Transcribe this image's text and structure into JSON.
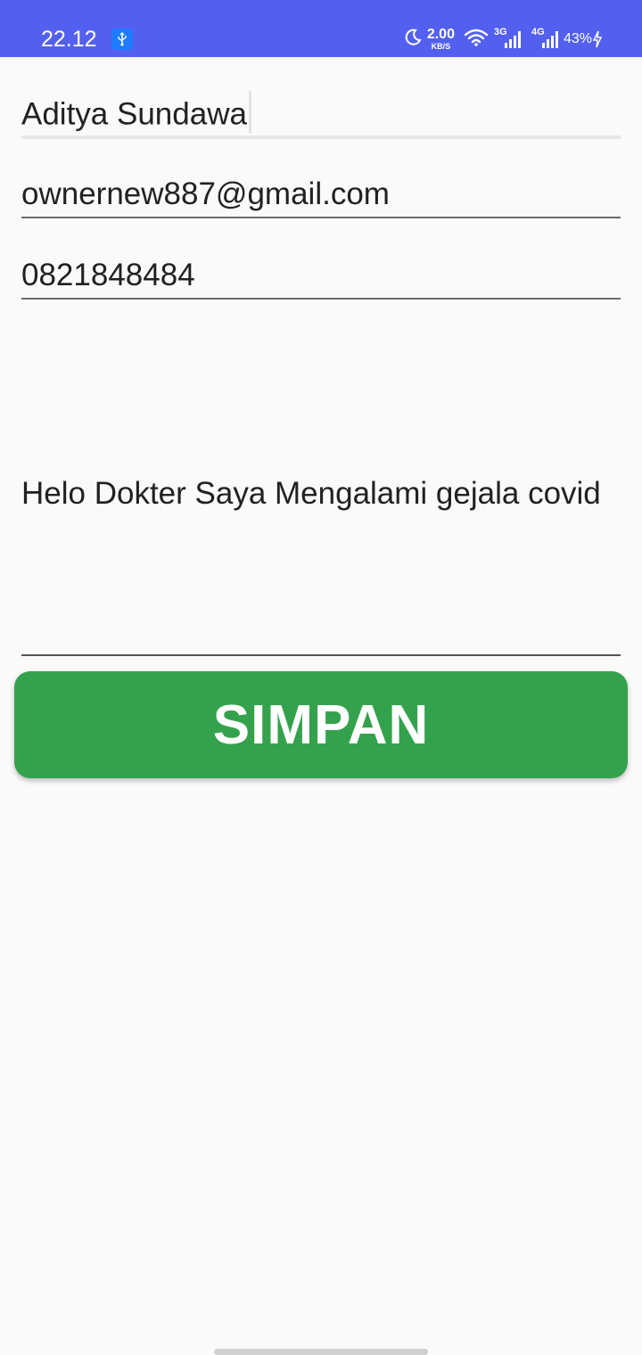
{
  "status_bar": {
    "time": "22.12",
    "speed_value": "2.00",
    "speed_unit": "KB/S",
    "network_1": "3G",
    "network_2": "4G",
    "battery": "43%",
    "colors": {
      "background": "#5360ef"
    }
  },
  "form": {
    "name_value": "Aditya Sundawa",
    "email_value": "ownernew887@gmail.com",
    "phone_value": "0821848484",
    "message_value": "Helo Dokter Saya Mengalami gejala covid"
  },
  "save_button": {
    "label": "SIMPAN",
    "color": "#34a24d"
  }
}
